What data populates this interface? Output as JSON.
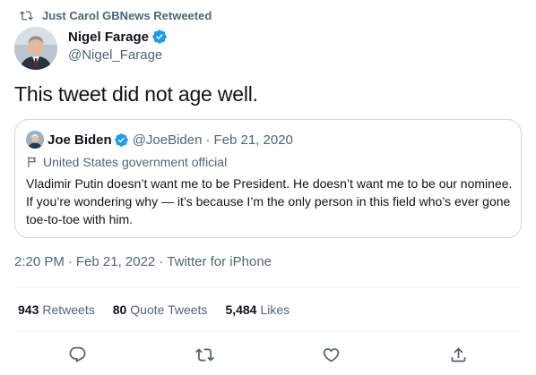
{
  "retweet_context": {
    "label": "Just Carol GBNews Retweeted",
    "icon": "retweet-icon"
  },
  "author": {
    "display_name": "Nigel Farage",
    "handle": "@Nigel_Farage",
    "verified": true
  },
  "tweet": {
    "text": "This tweet did not age well."
  },
  "quoted_tweet": {
    "display_name": "Joe Biden",
    "handle": "@JoeBiden",
    "separator": "·",
    "date": "Feb 21, 2020",
    "label": "United States government official",
    "text": "Vladimir Putin doesn’t want me to be President. He doesn’t want me to be our nominee. If you’re wondering why — it’s because I’m the only person in this field who’s ever gone toe-to-toe with him."
  },
  "meta": {
    "time": "2:20 PM",
    "separator": "·",
    "date": "Feb 21, 2022",
    "source": "Twitter for iPhone"
  },
  "stats": {
    "retweets_count": "943",
    "retweets_label": "Retweets",
    "quotes_count": "80",
    "quotes_label": "Quote Tweets",
    "likes_count": "5,484",
    "likes_label": "Likes"
  },
  "actions": [
    "reply-icon",
    "retweet-icon",
    "like-icon",
    "share-icon"
  ],
  "colors": {
    "text": "#0f1419",
    "secondary": "#536471",
    "verified": "#1d9bf0",
    "border": "#cfd9de",
    "divider": "#eff3f4"
  }
}
